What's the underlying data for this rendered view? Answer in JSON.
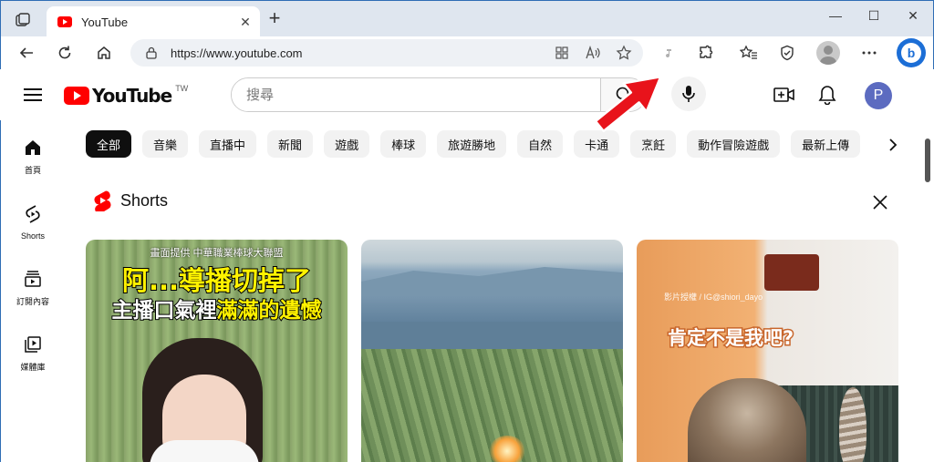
{
  "browser": {
    "tab": {
      "title": "YouTube",
      "close_glyph": "✕"
    },
    "new_tab_glyph": "+",
    "window_controls": {
      "minimize": "—",
      "maximize": "☐",
      "close": "✕"
    },
    "address": {
      "url": "https://www.youtube.com"
    },
    "icons": [
      "tab-actions-icon",
      "back-icon",
      "refresh-icon",
      "home-icon",
      "lock-icon",
      "app-available-icon",
      "read-aloud-icon",
      "favorite-star-icon",
      "extension-icon",
      "puzzle-extensions-icon",
      "favorites-icon",
      "browser-essentials-icon",
      "profile-icon",
      "more-icon",
      "bing-copilot-icon"
    ],
    "bing_letter": "b"
  },
  "youtube": {
    "logo_text": "YouTube",
    "country_code": "TW",
    "search": {
      "placeholder": "搜尋"
    },
    "avatar_letter": "P",
    "guide": [
      {
        "label": "首頁",
        "icon": "home-icon"
      },
      {
        "label": "Shorts",
        "icon": "shorts-icon"
      },
      {
        "label": "訂閱內容",
        "icon": "subscriptions-icon"
      },
      {
        "label": "媒體庫",
        "icon": "library-icon"
      }
    ],
    "chips": [
      "全部",
      "音樂",
      "直播中",
      "新聞",
      "遊戲",
      "棒球",
      "旅遊勝地",
      "自然",
      "卡通",
      "烹飪",
      "動作冒險遊戲",
      "最新上傳"
    ],
    "active_chip": "全部",
    "shorts": {
      "title": "Shorts",
      "cards": [
        {
          "caption": "畫面提供  中華職業棒球大聯盟",
          "line1": "阿...導播切掉了",
          "line2_a": "主播口氣裡",
          "line2_b": "滿滿的遺憾"
        },
        {},
        {
          "watermark": "影片授權 / IG@shiori_dayo",
          "overlay_text": "肯定不是我吧?"
        }
      ]
    },
    "colors": {
      "brand_red": "#ff0000",
      "chip_active": "#0f0f0f",
      "avatar": "#5c6bc0",
      "arrow": "#e8131b"
    }
  }
}
